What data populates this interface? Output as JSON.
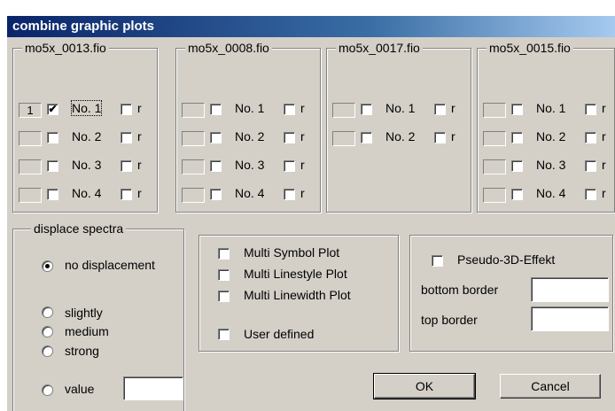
{
  "window": {
    "title": "combine graphic plots"
  },
  "files": [
    {
      "name": "mo5x_0013.fio",
      "rows": [
        {
          "num": "1",
          "checked": true,
          "label": "No. 1",
          "r": "r",
          "focused": true
        },
        {
          "num": "",
          "checked": false,
          "label": "No. 2",
          "r": "r"
        },
        {
          "num": "",
          "checked": false,
          "label": "No. 3",
          "r": "r"
        },
        {
          "num": "",
          "checked": false,
          "label": "No. 4",
          "r": "r"
        }
      ]
    },
    {
      "name": "mo5x_0008.fio",
      "rows": [
        {
          "num": "",
          "checked": false,
          "label": "No. 1",
          "r": "r"
        },
        {
          "num": "",
          "checked": false,
          "label": "No. 2",
          "r": "r"
        },
        {
          "num": "",
          "checked": false,
          "label": "No. 3",
          "r": "r"
        },
        {
          "num": "",
          "checked": false,
          "label": "No. 4",
          "r": "r"
        }
      ]
    },
    {
      "name": "mo5x_0017.fio",
      "rows": [
        {
          "num": "",
          "checked": false,
          "label": "No. 1",
          "r": "r"
        },
        {
          "num": "",
          "checked": false,
          "label": "No. 2",
          "r": "r"
        }
      ]
    },
    {
      "name": "mo5x_0015.fio",
      "rows": [
        {
          "num": "",
          "checked": false,
          "label": "No. 1",
          "r": "r"
        },
        {
          "num": "",
          "checked": false,
          "label": "No. 2",
          "r": "r"
        },
        {
          "num": "",
          "checked": false,
          "label": "No. 3",
          "r": "r"
        },
        {
          "num": "",
          "checked": false,
          "label": "No. 4",
          "r": "r"
        }
      ]
    }
  ],
  "displace": {
    "legend": "displace spectra",
    "no_displacement": "no displacement",
    "slightly": "slightly",
    "medium": "medium",
    "strong": "strong",
    "value": "value",
    "value_input": "",
    "selected": "no_displacement"
  },
  "plot_options": {
    "multi_symbol": "Multi Symbol Plot",
    "multi_linestyle": "Multi Linestyle Plot",
    "multi_linewidth": "Multi Linewidth Plot",
    "user_defined": "User defined"
  },
  "pseudo3d": {
    "label": "Pseudo-3D-Effekt",
    "bottom_border_label": "bottom border",
    "bottom_border_value": "",
    "top_border_label": "top border",
    "top_border_value": ""
  },
  "buttons": {
    "ok": "OK",
    "cancel": "Cancel"
  }
}
